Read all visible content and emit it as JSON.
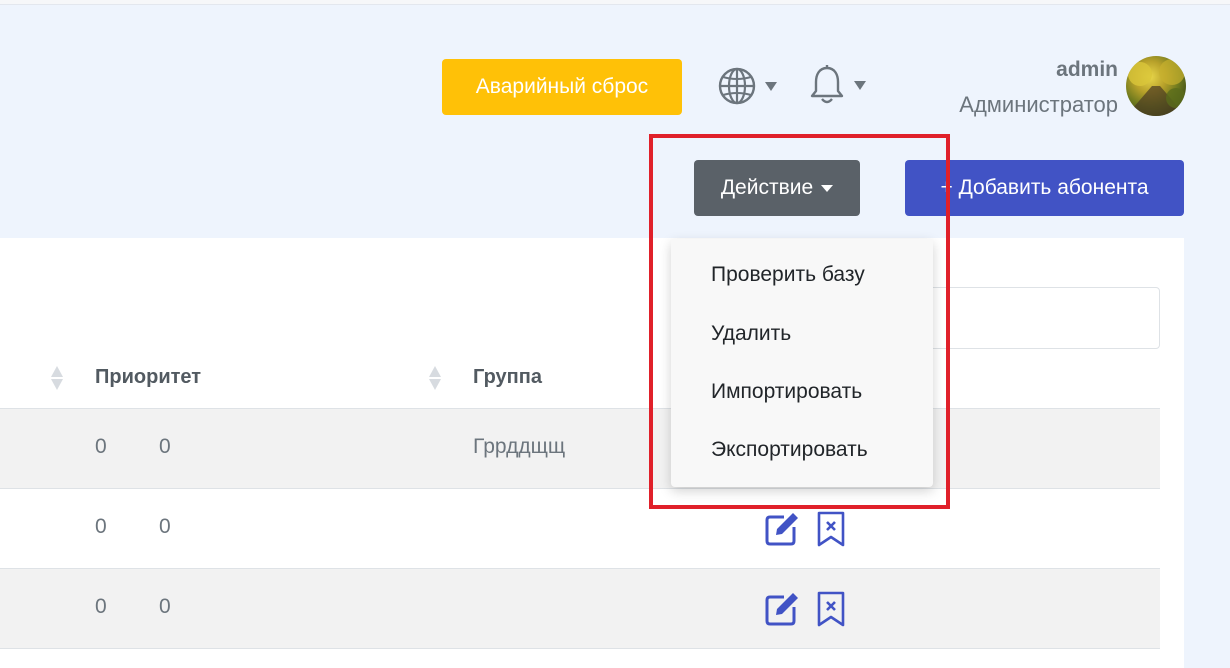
{
  "header": {
    "emergency_reset_label": "Аварийный сброс",
    "globe_icon": "globe-icon",
    "bell_icon": "bell-icon",
    "user": {
      "name": "admin",
      "role": "Администратор"
    }
  },
  "toolbar": {
    "action_label": "Действие",
    "add_subscriber_label": "+ Добавить абонента"
  },
  "dropdown": {
    "items": [
      "Проверить базу",
      "Удалить",
      "Импортировать",
      "Экспортировать"
    ]
  },
  "table": {
    "columns": [
      "Приоритет",
      "Группа"
    ],
    "rows": [
      {
        "v1": "0",
        "v2": "0",
        "group": "Гррддщщ"
      },
      {
        "v1": "0",
        "v2": "0",
        "group": ""
      },
      {
        "v1": "0",
        "v2": "0",
        "group": ""
      }
    ]
  },
  "colors": {
    "emergency": "#ffc107",
    "action": "#5a6168",
    "primary": "#4153c5",
    "highlight": "#e0202a",
    "icon_blue": "#4153c5"
  }
}
